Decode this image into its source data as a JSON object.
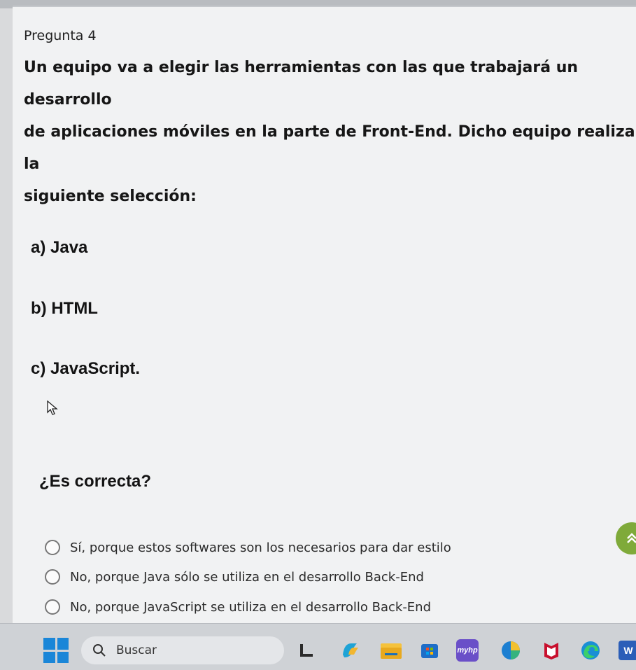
{
  "question": {
    "number_label": "Pregunta 4",
    "stem": "Un equipo va a elegir las herramientas con las que trabajará un desarrollo\nde aplicaciones móviles en la parte de Front-End. Dicho equipo realiza la\nsiguiente selección:",
    "items": [
      {
        "label": "a) Java"
      },
      {
        "label": "b) HTML"
      },
      {
        "label": "c) JavaScript."
      }
    ],
    "prompt": "¿Es correcta?",
    "options": [
      {
        "label": "Sí, porque estos softwares son los necesarios para dar estilo",
        "selected": false
      },
      {
        "label": "No, porque Java sólo se utiliza en el desarrollo Back-End",
        "selected": false
      },
      {
        "label": "No, porque JavaScript se utiliza en el desarrollo Back-End",
        "selected": false
      }
    ]
  },
  "scroll_button": {
    "icon": "double-chevron-up-icon",
    "color": "#7faa3a"
  },
  "taskbar": {
    "search_placeholder": "Buscar",
    "apps": [
      {
        "icon": "windows-start-icon"
      },
      {
        "icon": "task-view-icon"
      },
      {
        "icon": "copilot-icon"
      },
      {
        "icon": "file-explorer-icon"
      },
      {
        "icon": "microsoft-store-icon"
      },
      {
        "icon": "myhp-icon",
        "text": "myhp"
      },
      {
        "icon": "pinwheel-app-icon"
      },
      {
        "icon": "mcafee-icon"
      },
      {
        "icon": "edge-icon"
      },
      {
        "icon": "word-icon",
        "text": "W"
      }
    ]
  }
}
